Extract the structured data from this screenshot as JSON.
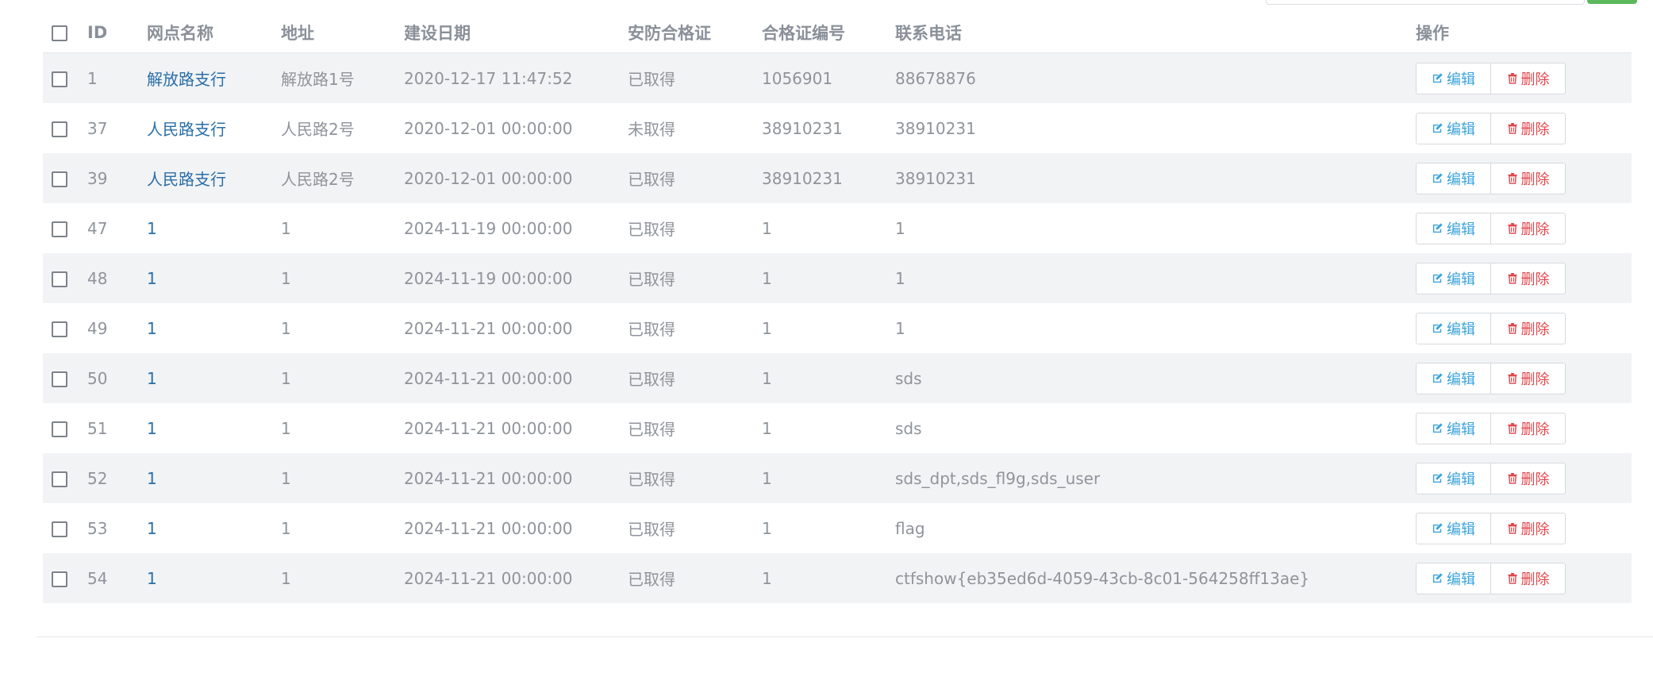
{
  "table": {
    "headers": {
      "id": "ID",
      "name": "网点名称",
      "address": "地址",
      "build_date": "建设日期",
      "security_cert": "安防合格证",
      "cert_no": "合格证编号",
      "phone": "联系电话",
      "actions": "操作"
    },
    "rows": [
      {
        "id": "1",
        "name": "解放路支行",
        "address": "解放路1号",
        "build_date": "2020-12-17 11:47:52",
        "security_cert": "已取得",
        "cert_no": "1056901",
        "phone": "88678876"
      },
      {
        "id": "37",
        "name": "人民路支行",
        "address": "人民路2号",
        "build_date": "2020-12-01 00:00:00",
        "security_cert": "未取得",
        "cert_no": "38910231",
        "phone": "38910231"
      },
      {
        "id": "39",
        "name": "人民路支行",
        "address": "人民路2号",
        "build_date": "2020-12-01 00:00:00",
        "security_cert": "已取得",
        "cert_no": "38910231",
        "phone": "38910231"
      },
      {
        "id": "47",
        "name": "1",
        "address": "1",
        "build_date": "2024-11-19 00:00:00",
        "security_cert": "已取得",
        "cert_no": "1",
        "phone": "1"
      },
      {
        "id": "48",
        "name": "1",
        "address": "1",
        "build_date": "2024-11-19 00:00:00",
        "security_cert": "已取得",
        "cert_no": "1",
        "phone": "1"
      },
      {
        "id": "49",
        "name": "1",
        "address": "1",
        "build_date": "2024-11-21 00:00:00",
        "security_cert": "已取得",
        "cert_no": "1",
        "phone": "1"
      },
      {
        "id": "50",
        "name": "1",
        "address": "1",
        "build_date": "2024-11-21 00:00:00",
        "security_cert": "已取得",
        "cert_no": "1",
        "phone": "sds"
      },
      {
        "id": "51",
        "name": "1",
        "address": "1",
        "build_date": "2024-11-21 00:00:00",
        "security_cert": "已取得",
        "cert_no": "1",
        "phone": "sds"
      },
      {
        "id": "52",
        "name": "1",
        "address": "1",
        "build_date": "2024-11-21 00:00:00",
        "security_cert": "已取得",
        "cert_no": "1",
        "phone": "sds_dpt,sds_fl9g,sds_user"
      },
      {
        "id": "53",
        "name": "1",
        "address": "1",
        "build_date": "2024-11-21 00:00:00",
        "security_cert": "已取得",
        "cert_no": "1",
        "phone": "flag"
      },
      {
        "id": "54",
        "name": "1",
        "address": "1",
        "build_date": "2024-11-21 00:00:00",
        "security_cert": "已取得",
        "cert_no": "1",
        "phone": "ctfshow{eb35ed6d-4059-43cb-8c01-564258ff13ae}"
      }
    ],
    "actions": {
      "edit_label": "编辑",
      "delete_label": "删除",
      "edit_icon": "edit-icon",
      "delete_icon": "trash-icon"
    }
  },
  "colors": {
    "link": "#2a6fa8",
    "edit": "#3aa3d8",
    "delete": "#e0474c",
    "stripe": "#f2f3f5",
    "success": "#5cb85c"
  }
}
